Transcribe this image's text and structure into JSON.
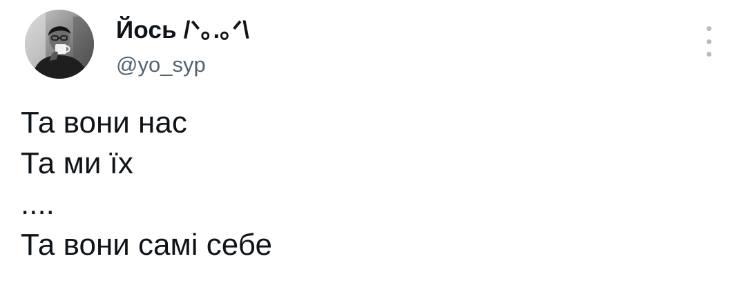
{
  "author": {
    "display_name": "Йось /ᐠ｡.｡ᐟ\\",
    "handle": "@yo_syp",
    "avatar_icon": "profile-photo"
  },
  "tweet": {
    "lines": [
      "Та вони нас",
      "Та ми їх",
      "....",
      "Та вони самі себе"
    ]
  },
  "menu": {
    "icon": "more-vertical-icon"
  },
  "colors": {
    "text": "#0f1419",
    "secondary": "#536471",
    "dots": "#b0bec5",
    "background": "#ffffff"
  }
}
